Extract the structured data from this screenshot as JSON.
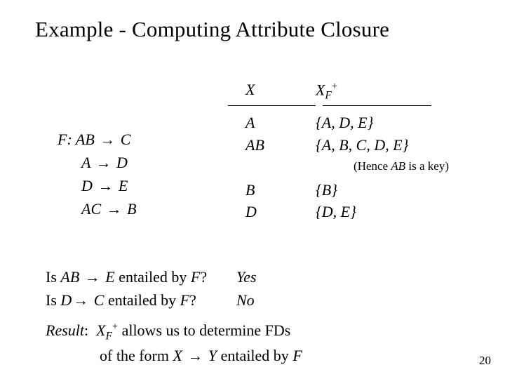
{
  "title": "Example - Computing Attribute Closure",
  "table": {
    "header_x": "X",
    "header_xf_var": "X",
    "header_xf_sub": "F",
    "header_xf_sup": "+"
  },
  "rows1": [
    {
      "x": "A",
      "xf": "{A, D, E}"
    },
    {
      "x": "AB",
      "xf": "{A, B, C, D, E}"
    }
  ],
  "note_prefix": "(Hence ",
  "note_it": "AB",
  "note_suffix": " is a key)",
  "rows2": [
    {
      "x": "B",
      "xf": "{B}"
    },
    {
      "x": "D",
      "xf": "{D, E}"
    }
  ],
  "fd_label": "F:",
  "fds": [
    {
      "lhs": "AB",
      "rhs": "C"
    },
    {
      "lhs": "A",
      "rhs": "D"
    },
    {
      "lhs": "D",
      "rhs": "E"
    },
    {
      "lhs": "AC",
      "rhs": "B"
    }
  ],
  "q1": {
    "pre": "Is  ",
    "lhs": "AB",
    "rhs": "E",
    "mid": " entailed by ",
    "fvar": "F",
    "post": "?",
    "ans": "Yes"
  },
  "q2": {
    "pre": "Is  ",
    "lhs": "D",
    "rhs": "C",
    "mid": "  entailed by ",
    "fvar": "F",
    "post": "?",
    "ans": "No"
  },
  "result": {
    "label": "Result",
    "colon": ":",
    "x": "X",
    "sub": "F",
    "sup": "+",
    "line1_rest": " allows us to determine FDs",
    "line2_pre": "of the form ",
    "line2_x": "X",
    "line2_y": "Y",
    "line2_mid": "  entailed by ",
    "line2_f": "F"
  },
  "pagenum": "20",
  "arrow": "→"
}
